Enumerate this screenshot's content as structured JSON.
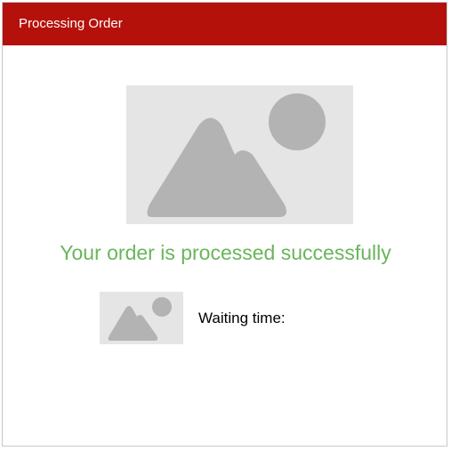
{
  "dialog": {
    "title": "Processing Order",
    "hero_image_icon": "image-placeholder-icon",
    "message": "Your order is processed successfully",
    "thumbnail_icon": "image-placeholder-icon",
    "waiting_label": "Waiting time:"
  },
  "colors": {
    "header_bg": "#b5110b",
    "header_text": "#ffffff",
    "success_text": "#6ab55b",
    "placeholder_bg": "#e5e5e5",
    "placeholder_shape": "#b3b3b3"
  }
}
